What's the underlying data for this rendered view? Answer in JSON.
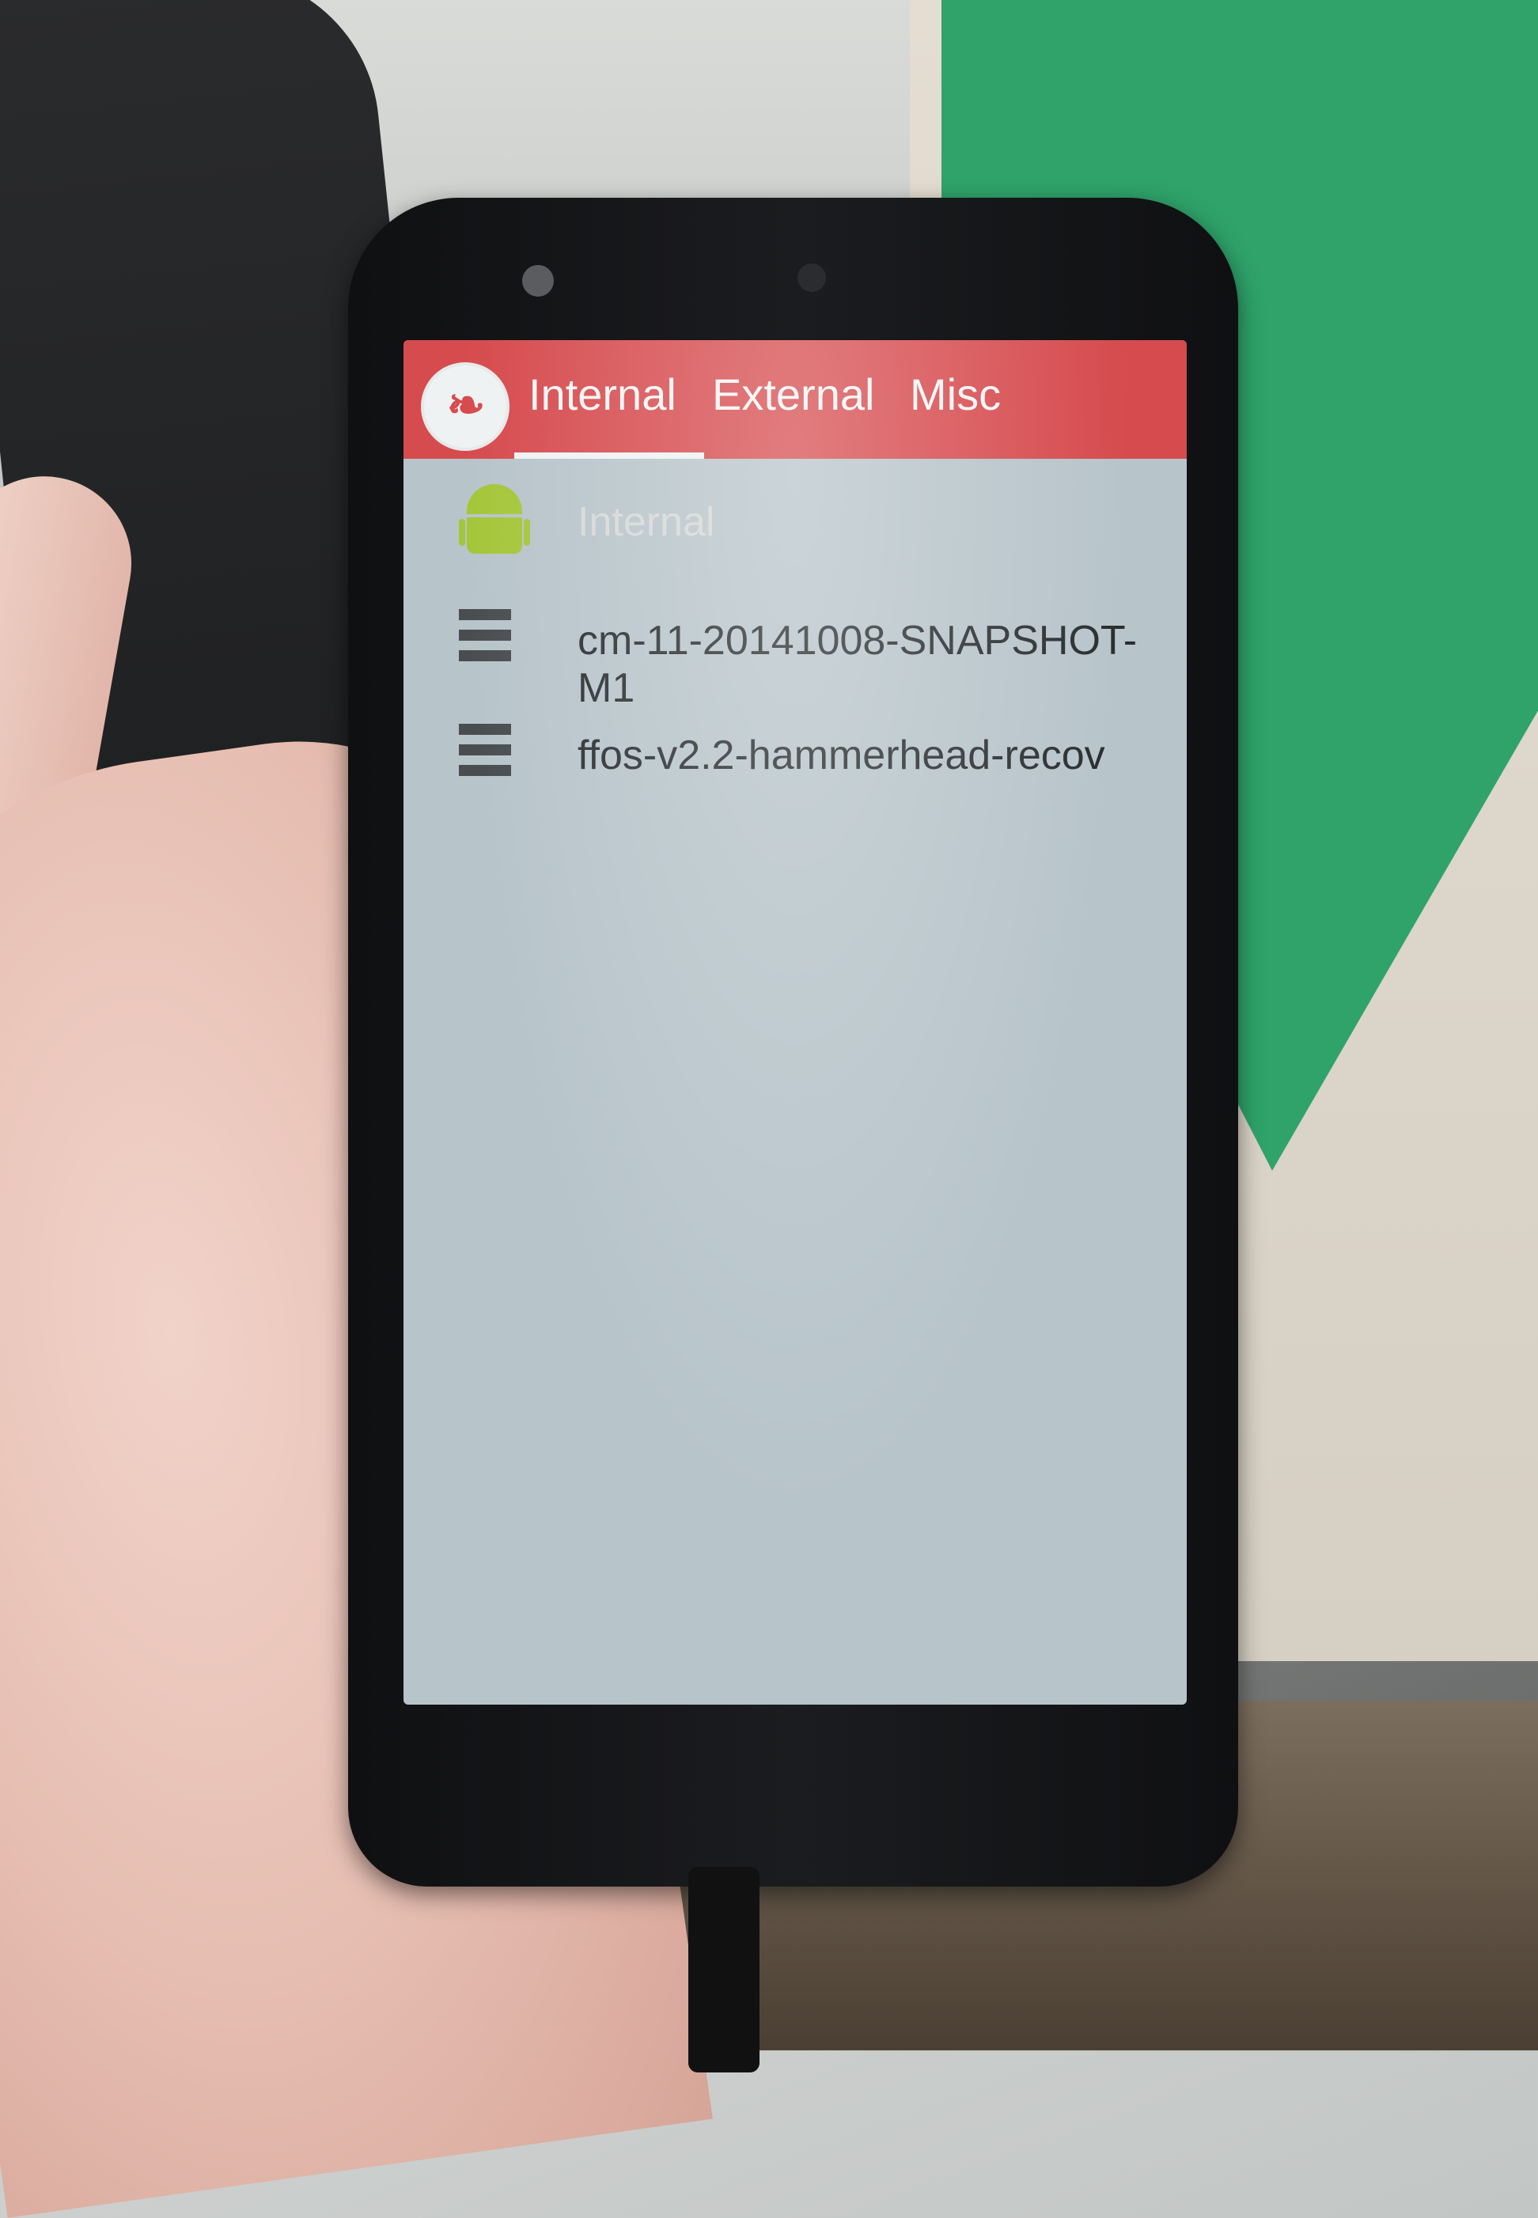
{
  "tabs": [
    {
      "label": "Internal",
      "selected": true
    },
    {
      "label": "External",
      "selected": false
    },
    {
      "label": "Misc",
      "selected": false
    }
  ],
  "list": [
    {
      "label": "Internal",
      "icon": "android-icon"
    },
    {
      "label": "cm-11-20141008-SNAPSHOT-M1",
      "icon": "file-icon"
    },
    {
      "label": "ffos-v2.2-hammerhead-recov",
      "icon": "file-icon"
    }
  ],
  "colors": {
    "appbar": "#d64b4e",
    "screen_background": "#b7c4ca",
    "android_green": "#a4c639"
  }
}
